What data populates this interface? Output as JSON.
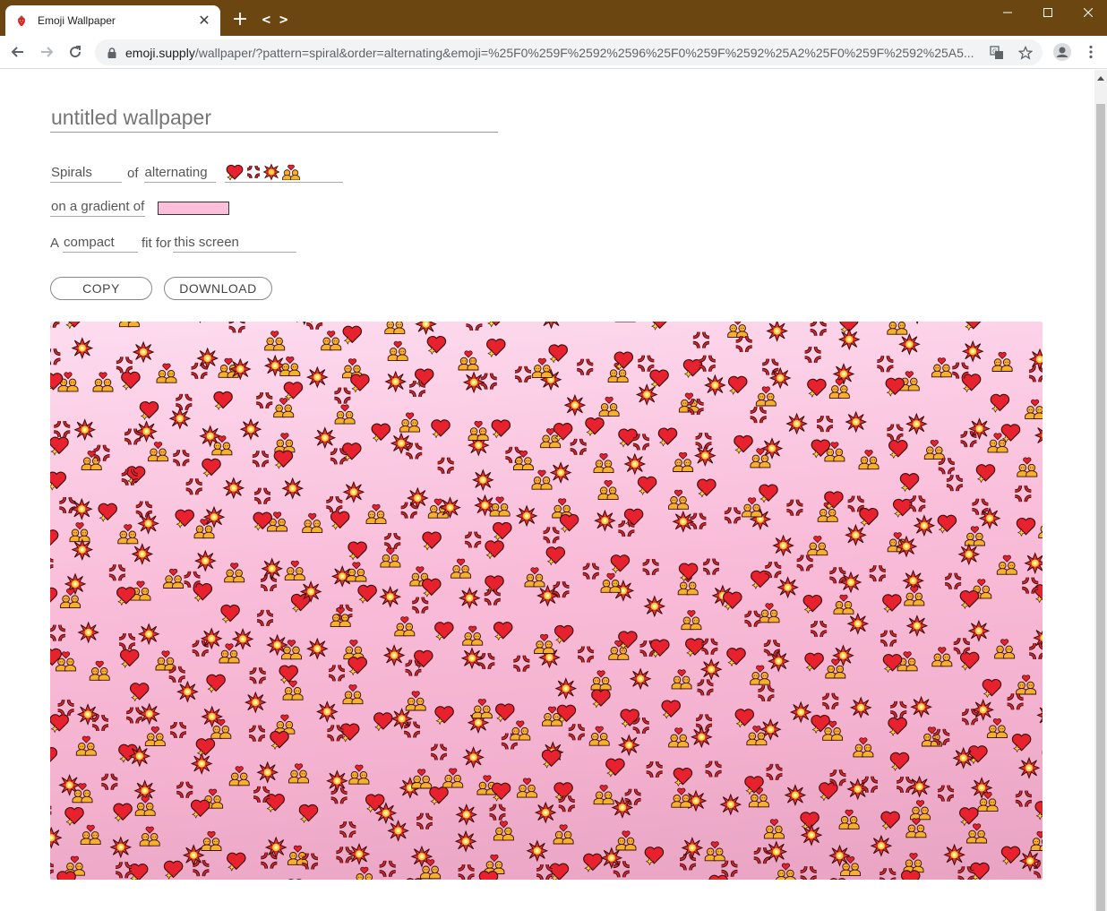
{
  "browser": {
    "tab_title": "Emoji Wallpaper",
    "new_tab_label": "+",
    "code_label": "< >",
    "url_host": "emoji.supply",
    "url_path": "/wallpaper/?pattern=spiral&order=alternating&emoji=%25F0%259F%2592%2596%25F0%259F%2592%25A2%25F0%259F%2592%25A5..."
  },
  "editor": {
    "title_placeholder": "untitled wallpaper",
    "pattern_value": "Spirals",
    "of_label": "of",
    "order_value": "alternating",
    "gradient_label": "on a gradient of",
    "gradient_color": "#fbbfdc",
    "fit_prefix": "A",
    "fit_value": "compact",
    "fit_label": "fit for",
    "fit_target": "this screen",
    "emoji_icons": [
      "sparkling-heart",
      "anger-symbol",
      "collision",
      "couple-with-heart"
    ]
  },
  "buttons": {
    "copy_label": "COPY",
    "download_label": "DOWNLOAD"
  },
  "wallpaper": {
    "pattern": "spiral",
    "order": "alternating",
    "emoji_icons": [
      "sparkling-heart",
      "anger-symbol",
      "collision",
      "couple-with-heart"
    ],
    "gradient_colors": [
      "#fddcef",
      "#f4b3d0",
      "#e8a3c2"
    ]
  },
  "colors": {
    "titlebar": "#6b4610",
    "heart": "#e8212e",
    "anger": "#d22630",
    "collision_outer": "#e8302a",
    "collision_inner": "#fcd33a"
  }
}
